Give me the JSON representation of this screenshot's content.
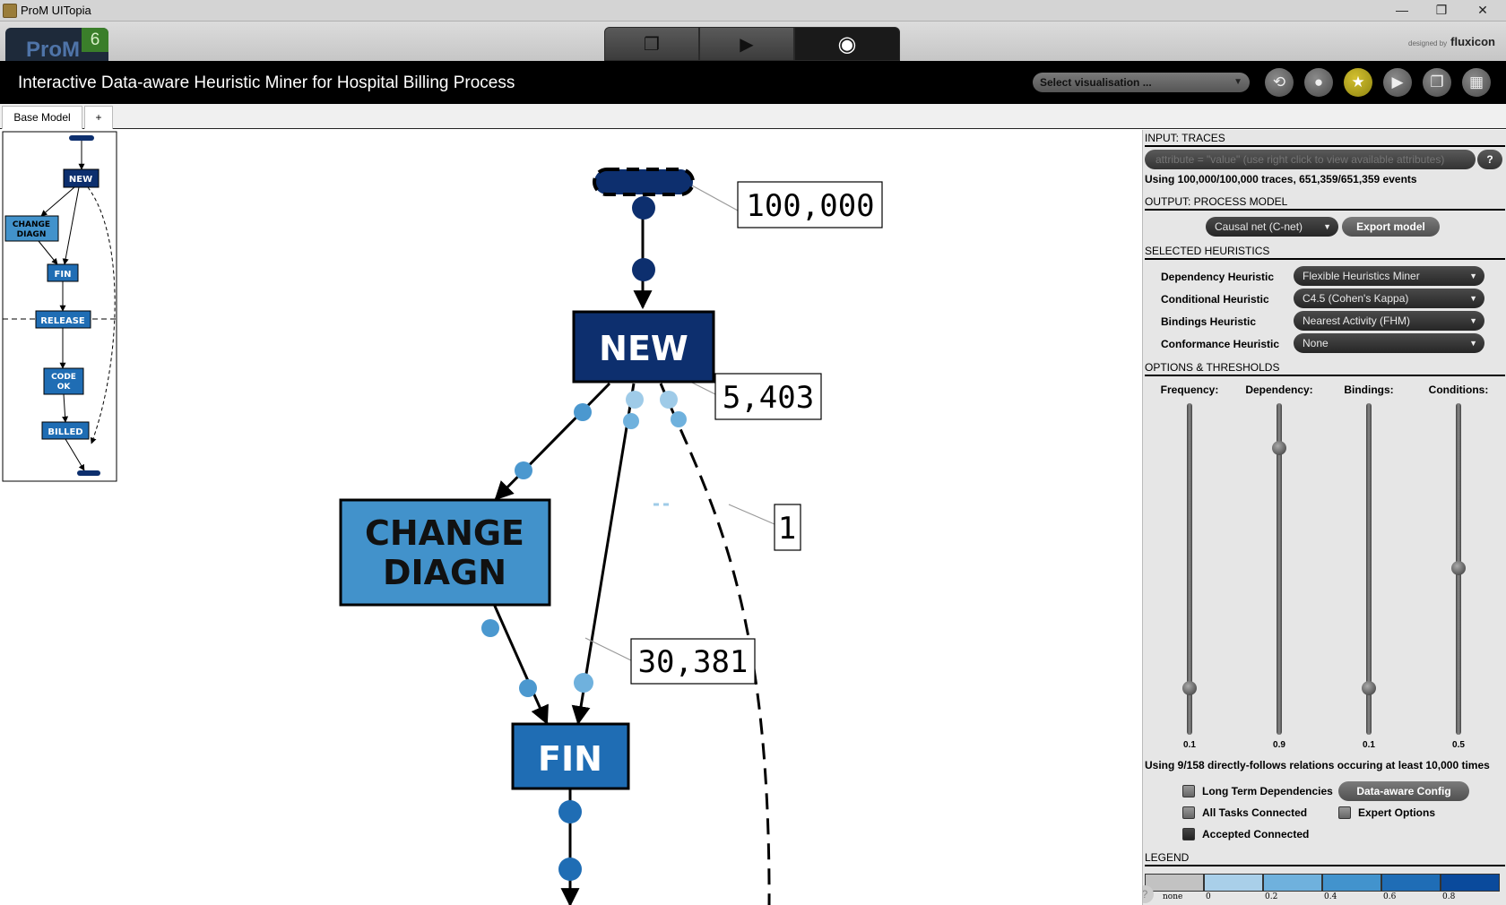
{
  "window": {
    "title": "ProM UITopia",
    "minimize": "—",
    "restore": "❐",
    "close": "✕"
  },
  "topbar": {
    "logo_text": "ProM",
    "logo_version": "6",
    "designed_by": "designed by",
    "brand": "fluxicon",
    "tabs": [
      {
        "name": "workspace-icon",
        "glyph": "❐"
      },
      {
        "name": "play-icon",
        "glyph": "▶"
      },
      {
        "name": "eye-icon",
        "glyph": "◉"
      }
    ]
  },
  "header": {
    "title": "Interactive Data-aware Heuristic Miner for Hospital Billing Process",
    "select_label": "Select visualisation ...",
    "select_arrow": "▼",
    "buttons": [
      {
        "name": "refresh-icon",
        "glyph": "⟲"
      },
      {
        "name": "drop-icon",
        "glyph": "●"
      },
      {
        "name": "star-icon",
        "glyph": "★"
      },
      {
        "name": "play-icon",
        "glyph": "▶"
      },
      {
        "name": "copy-icon",
        "glyph": "❐"
      },
      {
        "name": "grid-icon",
        "glyph": "▦"
      }
    ]
  },
  "tabs": {
    "base_model": "Base Model",
    "add": "+"
  },
  "canvas": {
    "nodes": {
      "new": "NEW",
      "change_line1": "CHANGE",
      "change_line2": "DIAGN",
      "fin": "FIN"
    },
    "counts": {
      "start": "100,000",
      "new_out": "5,403",
      "long_dep": "1",
      "fin_in": "30,381"
    }
  },
  "minimap": {
    "new": "NEW",
    "change_line1": "CHANGE",
    "change_line2": "DIAGN",
    "fin": "FIN",
    "release": "RELEASE",
    "code_line1": "CODE",
    "code_line2": "OK",
    "billed": "BILLED"
  },
  "panel": {
    "input_title": "INPUT: TRACES",
    "filter_placeholder": "attribute = \"value\" (use right click to view available attributes)",
    "help": "?",
    "traces_info": "Using 100,000/100,000 traces, 651,359/651,359 events",
    "output_title": "OUTPUT: PROCESS MODEL",
    "output_type": "Causal net (C-net)",
    "export_label": "Export model",
    "heuristics_title": "SELECTED HEURISTICS",
    "heuristics": [
      {
        "label": "Dependency Heuristic",
        "value": "Flexible Heuristics Miner"
      },
      {
        "label": "Conditional Heuristic",
        "value": "C4.5 (Cohen's Kappa)"
      },
      {
        "label": "Bindings Heuristic",
        "value": "Nearest Activity (FHM)"
      },
      {
        "label": "Conformance Heuristic",
        "value": "None"
      }
    ],
    "options_title": "OPTIONS & THRESHOLDS",
    "sliders": [
      {
        "label": "Frequency:",
        "value": "0.1",
        "level": 0.1
      },
      {
        "label": "Dependency:",
        "value": "0.9",
        "level": 0.9
      },
      {
        "label": "Bindings:",
        "value": "0.1",
        "level": 0.1
      },
      {
        "label": "Conditions:",
        "value": "0.5",
        "level": 0.5
      }
    ],
    "relations_info": "Using 9/158 directly-follows relations occuring at least 10,000 times",
    "long_term": "Long Term Dependencies",
    "data_aware": "Data-aware Config",
    "all_tasks": "All Tasks Connected",
    "expert": "Expert Options",
    "accepted": "Accepted Connected",
    "legend_title": "LEGEND",
    "legend_ticks": [
      "none",
      "0",
      "0.2",
      "0.4",
      "0.6",
      "0.8"
    ],
    "legend_colors": [
      "#c2c2c2",
      "#a9cfe9",
      "#6fb1dd",
      "#4293cd",
      "#1f6db6",
      "#0a4a9c"
    ],
    "corner_help": "?"
  },
  "colors": {
    "new_node": "#0d2f6e",
    "change_node": "#4292cb",
    "fin_node": "#1f6db4",
    "dot_dark": "#0d2f6e",
    "dot_mid": "#4b98cf",
    "dot_light": "#9fcbe8"
  }
}
